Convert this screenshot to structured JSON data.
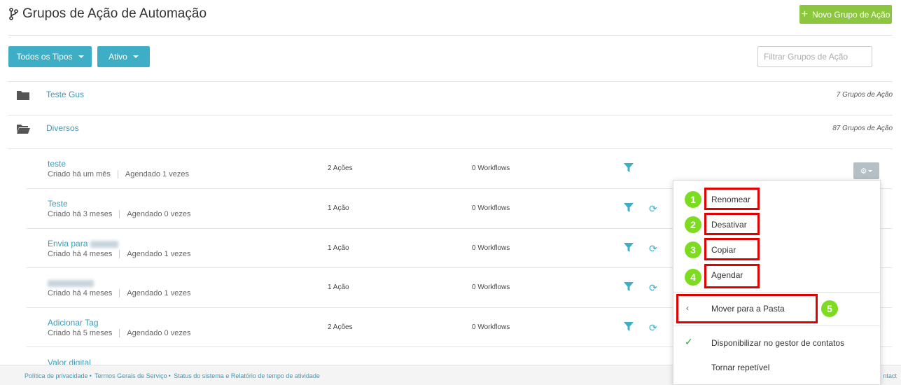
{
  "header": {
    "title": "Grupos de Ação de Automação",
    "new_button": "Novo Grupo de Ação"
  },
  "filters": {
    "type_label": "Todos os Tipos",
    "status_label": "Ativo",
    "search_placeholder": "Filtrar Grupos de Ação"
  },
  "folders": [
    {
      "name": "Teste Gus",
      "count": "7 Grupos de Ação"
    },
    {
      "name": "Diversos",
      "count": "87 Grupos de Ação"
    }
  ],
  "items": [
    {
      "name": "teste",
      "created": "Criado há um mês",
      "scheduled": "Agendado 1 vezes",
      "actions": "2 Ações",
      "workflows": "0 Workflows"
    },
    {
      "name": "Teste",
      "created": "Criado há 3 meses",
      "scheduled": "Agendado 0 vezes",
      "actions": "1 Ação",
      "workflows": "0 Workflows"
    },
    {
      "name": "Envia para",
      "created": "Criado há 4 meses",
      "scheduled": "Agendado 1 vezes",
      "actions": "1 Ação",
      "workflows": "0 Workflows"
    },
    {
      "name": "",
      "created": "Criado há 4 meses",
      "scheduled": "Agendado 1 vezes",
      "actions": "1 Ação",
      "workflows": "0 Workflows"
    },
    {
      "name": "Adicionar Tag",
      "created": "Criado há 5 meses",
      "scheduled": "Agendado 0 vezes",
      "actions": "2 Ações",
      "workflows": "0 Workflows"
    },
    {
      "name": "Valor digital",
      "created": "",
      "scheduled": "",
      "actions": "",
      "workflows": ""
    }
  ],
  "menu": {
    "rename": "Renomear",
    "disable": "Desativar",
    "copy": "Copiar",
    "schedule": "Agendar",
    "move": "Mover para a Pasta",
    "share": "Disponibilizar no gestor de contatos",
    "repeat": "Tornar repetível",
    "badges": [
      "1",
      "2",
      "3",
      "4",
      "5"
    ]
  },
  "footer": {
    "privacy": "Política de privacidade",
    "terms": "Termos Gerais de Serviço",
    "status": "Status do sistema e Relatório de tempo de atividade",
    "contact": "ntact"
  },
  "colors": {
    "accent": "#3eaec6",
    "green": "#8cc63f",
    "annotation_red": "#e00000",
    "badge_green": "#7ddc1f"
  },
  "icons": {
    "title": "branch-icon",
    "folder_closed": "folder-icon",
    "folder_open": "folder-open-icon",
    "filter": "filter-icon",
    "sync": "sync-icon",
    "gear": "gear-icon"
  }
}
